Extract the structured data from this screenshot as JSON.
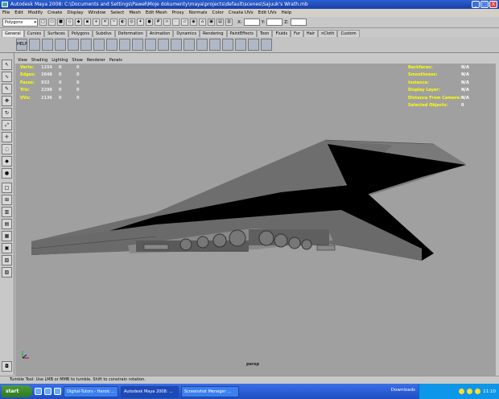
{
  "window": {
    "title": "Autodesk Maya 2008: C:\\Documents and Settings\\Paweł\\Moje dokumenty\\maya\\projects\\default\\scenes\\Sajuuk's Wrath.mb",
    "minimize": "_",
    "maximize": "□",
    "close": "X"
  },
  "menu": [
    "File",
    "Edit",
    "Modify",
    "Create",
    "Display",
    "Window",
    "Select",
    "Mesh",
    "Edit Mesh",
    "Proxy",
    "Normals",
    "Color",
    "Create UVs",
    "Edit UVs",
    "Help"
  ],
  "status_line": {
    "mode": "Polygons",
    "x_label": "X:",
    "y_label": "Y:",
    "z_label": "Z:"
  },
  "shelf_tabs": [
    "General",
    "Curves",
    "Surfaces",
    "Polygons",
    "Subdivs",
    "Deformation",
    "Animation",
    "Dynamics",
    "Rendering",
    "PaintEffects",
    "Toon",
    "Fluids",
    "Fur",
    "Hair",
    "nCloth",
    "Custom"
  ],
  "shelf_help": "HELP",
  "panel_menu": [
    "View",
    "Shading",
    "Lighting",
    "Show",
    "Renderer",
    "Panels"
  ],
  "hud_left": [
    {
      "label": "Verts:",
      "v1": "1154",
      "v2": "0",
      "v3": "0"
    },
    {
      "label": "Edges:",
      "v1": "2048",
      "v2": "0",
      "v3": "0"
    },
    {
      "label": "Faces:",
      "v1": "932",
      "v2": "0",
      "v3": "0"
    },
    {
      "label": "Tris:",
      "v1": "2298",
      "v2": "0",
      "v3": "0"
    },
    {
      "label": "UVs:",
      "v1": "2136",
      "v2": "0",
      "v3": "0"
    }
  ],
  "hud_right": [
    {
      "label": "Backfaces:",
      "value": "N/A"
    },
    {
      "label": "Smoothness:",
      "value": "N/A"
    },
    {
      "label": "Instance:",
      "value": "N/A"
    },
    {
      "label": "Display Layer:",
      "value": "N/A"
    },
    {
      "label": "Distance From Camera:",
      "value": "N/A"
    },
    {
      "label": "Selected Objects:",
      "value": "0"
    }
  ],
  "camera": "persp",
  "help_line": "Tumble Tool: Use LMB or MMB to tumble. Shift to constrain rotation.",
  "taskbar": {
    "start": "start",
    "items": [
      "Digital-Tutors - Heroic ...",
      "Autodesk Maya 2008: ...",
      "Screenshot Meneger ..."
    ],
    "downloads": "Downloads",
    "clock": "11:10"
  }
}
